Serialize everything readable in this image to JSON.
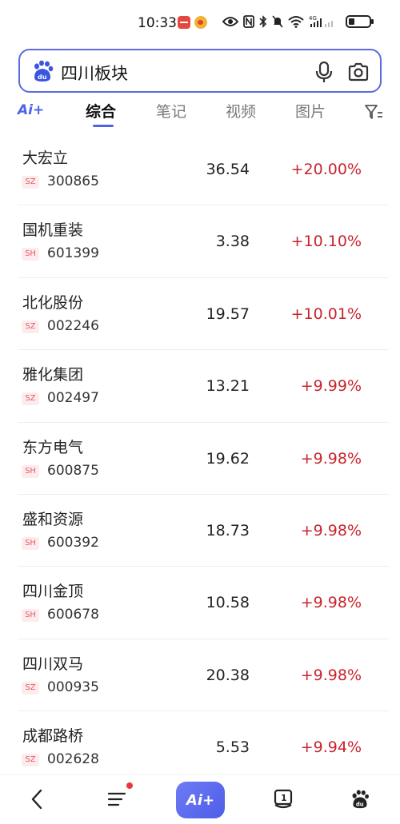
{
  "status_bar": {
    "time": "10:33",
    "network": "4G",
    "icons": [
      "minus-notification-icon",
      "weibo-icon",
      "eye-icon",
      "nfc-icon",
      "bluetooth-icon",
      "mute-icon",
      "wifi-icon",
      "signal-icon",
      "battery-icon"
    ],
    "battery_level": 0.2
  },
  "search": {
    "query": "四川板块",
    "icons": [
      "baidu-logo",
      "mic-icon",
      "camera-icon"
    ],
    "accent_color": "#5b6ae0"
  },
  "tabs": {
    "ai_label": "Ai+",
    "items": [
      {
        "label": "综合",
        "active": true
      },
      {
        "label": "笔记",
        "active": false
      },
      {
        "label": "视频",
        "active": false
      },
      {
        "label": "图片",
        "active": false
      }
    ]
  },
  "stocks": [
    {
      "name": "大宏立",
      "market": "SZ",
      "code": "300865",
      "price": "36.54",
      "change": "+20.00%"
    },
    {
      "name": "国机重装",
      "market": "SH",
      "code": "601399",
      "price": "3.38",
      "change": "+10.10%"
    },
    {
      "name": "北化股份",
      "market": "SZ",
      "code": "002246",
      "price": "19.57",
      "change": "+10.01%"
    },
    {
      "name": "雅化集团",
      "market": "SZ",
      "code": "002497",
      "price": "13.21",
      "change": "+9.99%"
    },
    {
      "name": "东方电气",
      "market": "SH",
      "code": "600875",
      "price": "19.62",
      "change": "+9.98%"
    },
    {
      "name": "盛和资源",
      "market": "SH",
      "code": "600392",
      "price": "18.73",
      "change": "+9.98%"
    },
    {
      "name": "四川金顶",
      "market": "SH",
      "code": "600678",
      "price": "10.58",
      "change": "+9.98%"
    },
    {
      "name": "四川双马",
      "market": "SZ",
      "code": "000935",
      "price": "20.38",
      "change": "+9.98%"
    },
    {
      "name": "成都路桥",
      "market": "SZ",
      "code": "002628",
      "price": "5.53",
      "change": "+9.94%"
    }
  ],
  "colors": {
    "up": "#c8242e",
    "badge_text": "#e45a62",
    "badge_bg": "#fdecee"
  },
  "bottom_nav": {
    "ai_label": "Ai+",
    "icons": [
      "back-icon",
      "menu-icon",
      "ai-button",
      "page-count-icon",
      "baidu-paw-icon"
    ],
    "page_count": "1"
  }
}
